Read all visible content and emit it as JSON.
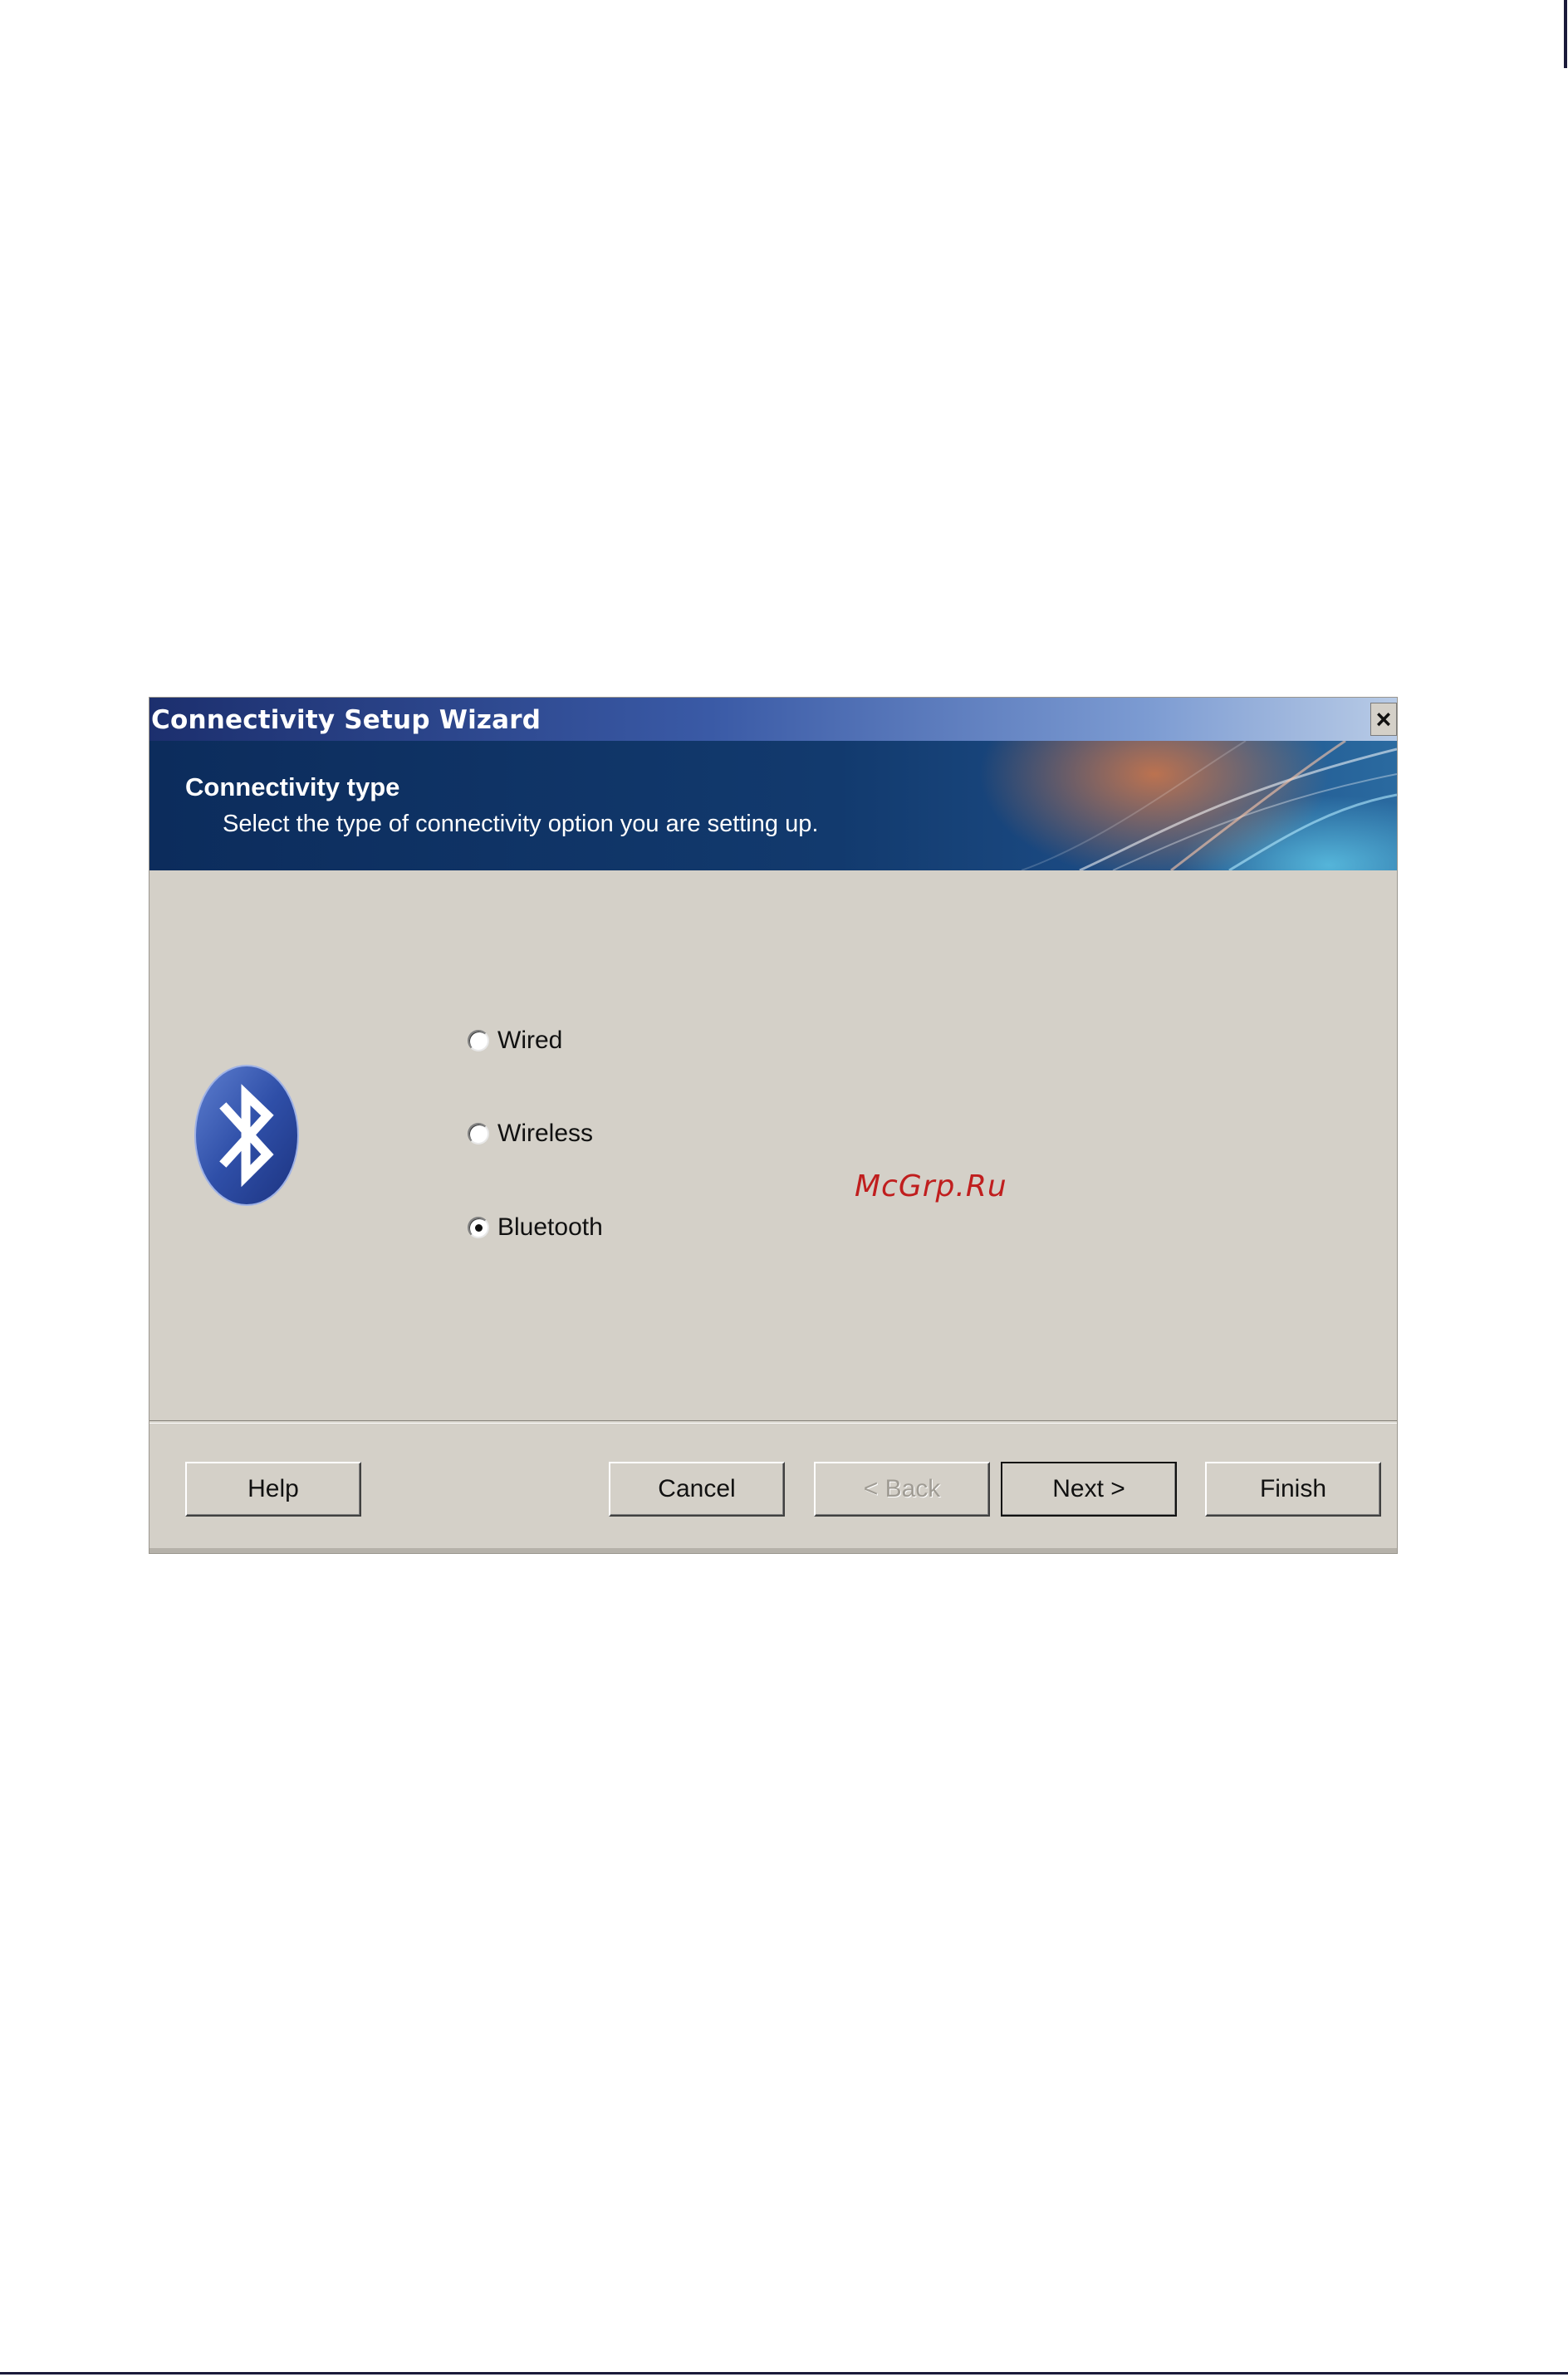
{
  "window": {
    "title": "Connectivity Setup Wizard",
    "close_glyph": "×"
  },
  "banner": {
    "title": "Connectivity type",
    "subtitle": "Select the type of connectivity option you are setting up."
  },
  "icons": {
    "banner_graphic": "abstract-swoosh-graphic",
    "connectivity_icon": "bluetooth-icon",
    "bluetooth_color": "#2f4fa8"
  },
  "options": [
    {
      "label": "Wired",
      "selected": false
    },
    {
      "label": "Wireless",
      "selected": false
    },
    {
      "label": "Bluetooth",
      "selected": true
    }
  ],
  "watermark": "McGrp.Ru",
  "buttons": {
    "help": "Help",
    "cancel": "Cancel",
    "back": "< Back",
    "next": "Next >",
    "finish": "Finish"
  },
  "colors": {
    "dialog_face": "#d4d0c8",
    "title_bar": "#1c2f6e",
    "watermark": "#c01e1e"
  }
}
